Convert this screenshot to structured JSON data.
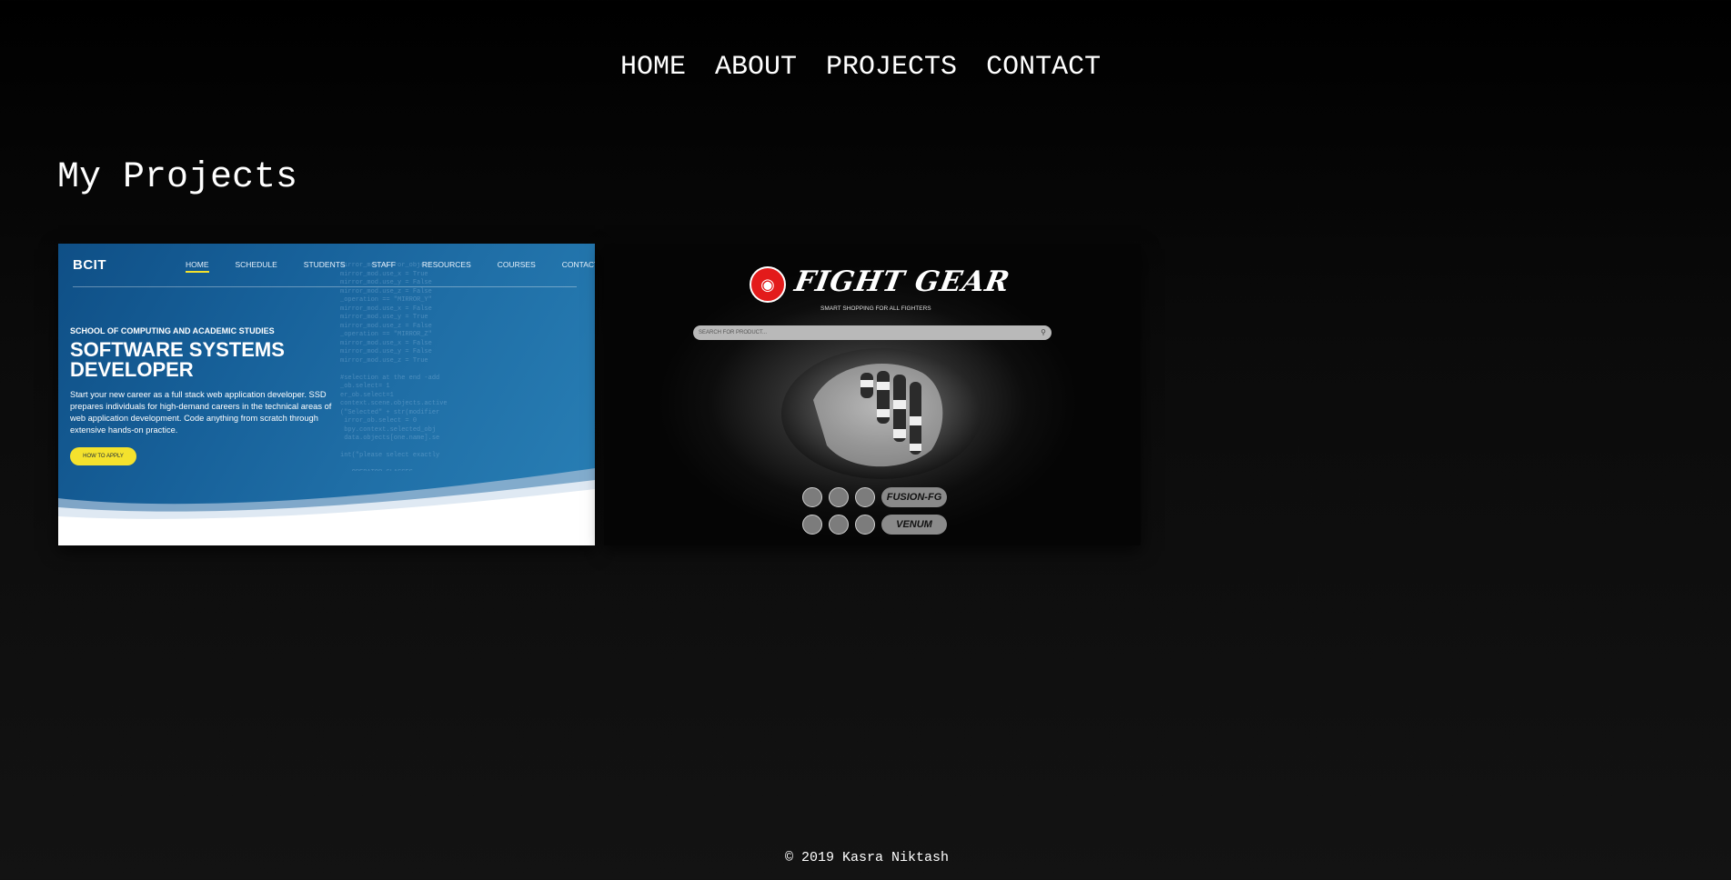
{
  "nav": {
    "items": [
      "HOME",
      "ABOUT",
      "PROJECTS",
      "CONTACT"
    ]
  },
  "page": {
    "title": "My Projects"
  },
  "projects": [
    {
      "logo": "BCIT",
      "menu": [
        "HOME",
        "SCHEDULE",
        "STUDENTS",
        "STAFF",
        "RESOURCES",
        "COURSES",
        "CONTACT"
      ],
      "kicker": "SCHOOL OF COMPUTING AND ACADEMIC STUDIES",
      "heading": "SOFTWARE SYSTEMS DEVELOPER",
      "description": "Start your new career as a full stack web application developer. SSD prepares individuals for high-demand careers in the technical areas of web application development. Code anything from scratch through extensive hands-on practice.",
      "button": "HOW TO APPLY"
    },
    {
      "brand": "FIGHT GEAR",
      "tagline": "SMART SHOPPING FOR ALL FIGHTERS",
      "search_placeholder": "SEARCH FOR PRODUCT...",
      "brand_pills": [
        "FUSION-FG",
        "VENUM"
      ]
    }
  ],
  "footer": {
    "text": "© 2019 Kasra Niktash"
  },
  "colors": {
    "background": "#0a0a0a",
    "text": "#ffffff",
    "bcit_yellow": "#f4e22d",
    "fight_red": "#e31b1b"
  }
}
